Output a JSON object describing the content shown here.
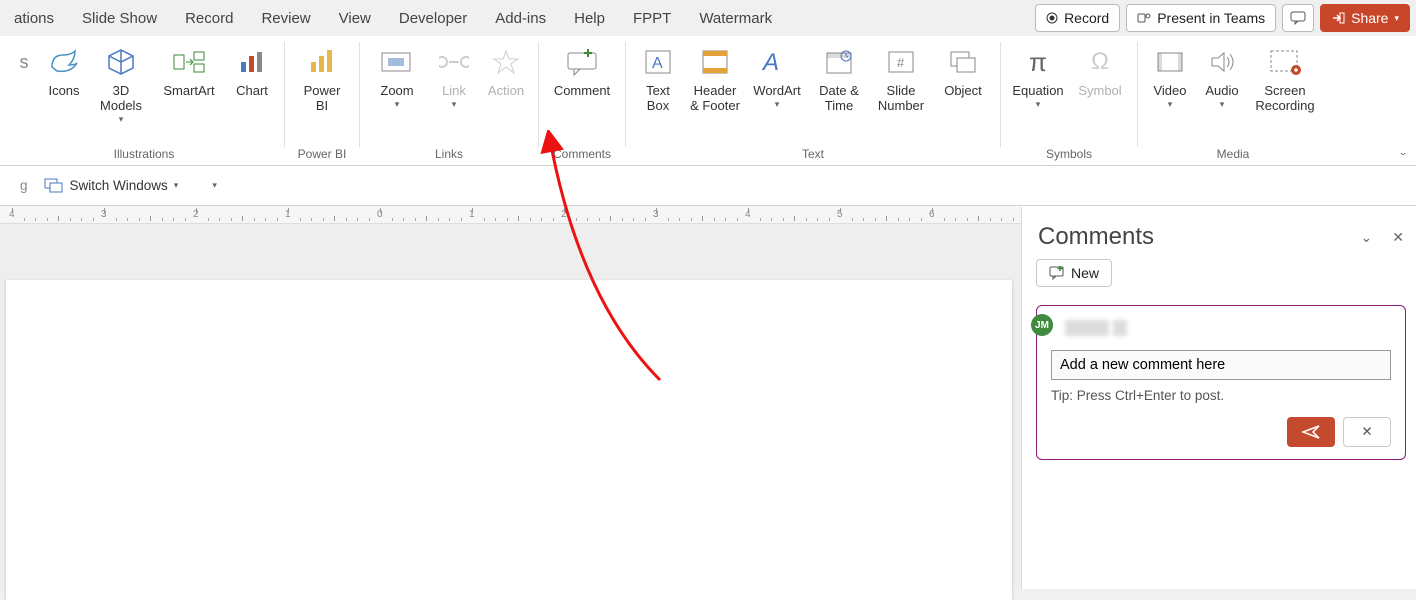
{
  "tabs": {
    "items": [
      "ations",
      "Slide Show",
      "Record",
      "Review",
      "View",
      "Developer",
      "Add-ins",
      "Help",
      "FPPT",
      "Watermark"
    ]
  },
  "title_buttons": {
    "record": "Record",
    "present": "Present in Teams",
    "share": "Share"
  },
  "ribbon": {
    "groups": {
      "illustrations": {
        "label": "Illustrations",
        "items": {
          "icons": "Icons",
          "models": "3D\nModels",
          "smartart": "SmartArt",
          "chart": "Chart"
        }
      },
      "powerbi": {
        "label": "Power BI",
        "items": {
          "powerbi": "Power\nBI"
        }
      },
      "links": {
        "label": "Links",
        "items": {
          "zoom": "Zoom",
          "link": "Link",
          "action": "Action"
        }
      },
      "comments": {
        "label": "Comments",
        "items": {
          "comment": "Comment"
        }
      },
      "text": {
        "label": "Text",
        "items": {
          "textbox": "Text\nBox",
          "headerfooter": "Header\n& Footer",
          "wordart": "WordArt",
          "datetime": "Date &\nTime",
          "slidenumber": "Slide\nNumber",
          "object": "Object"
        }
      },
      "symbols": {
        "label": "Symbols",
        "items": {
          "equation": "Equation",
          "symbol": "Symbol"
        }
      },
      "media": {
        "label": "Media",
        "items": {
          "video": "Video",
          "audio": "Audio",
          "screen": "Screen\nRecording"
        }
      }
    }
  },
  "secondary": {
    "switch": "Switch Windows"
  },
  "ruler": {
    "labels": [
      "4",
      "3",
      "2",
      "1",
      "0",
      "1",
      "2",
      "3",
      "4",
      "5",
      "6"
    ]
  },
  "comments_pane": {
    "title": "Comments",
    "new": "New",
    "avatar_initials": "JM",
    "input_value": "Add a new comment here",
    "tip": "Tip: Press Ctrl+Enter to post."
  }
}
